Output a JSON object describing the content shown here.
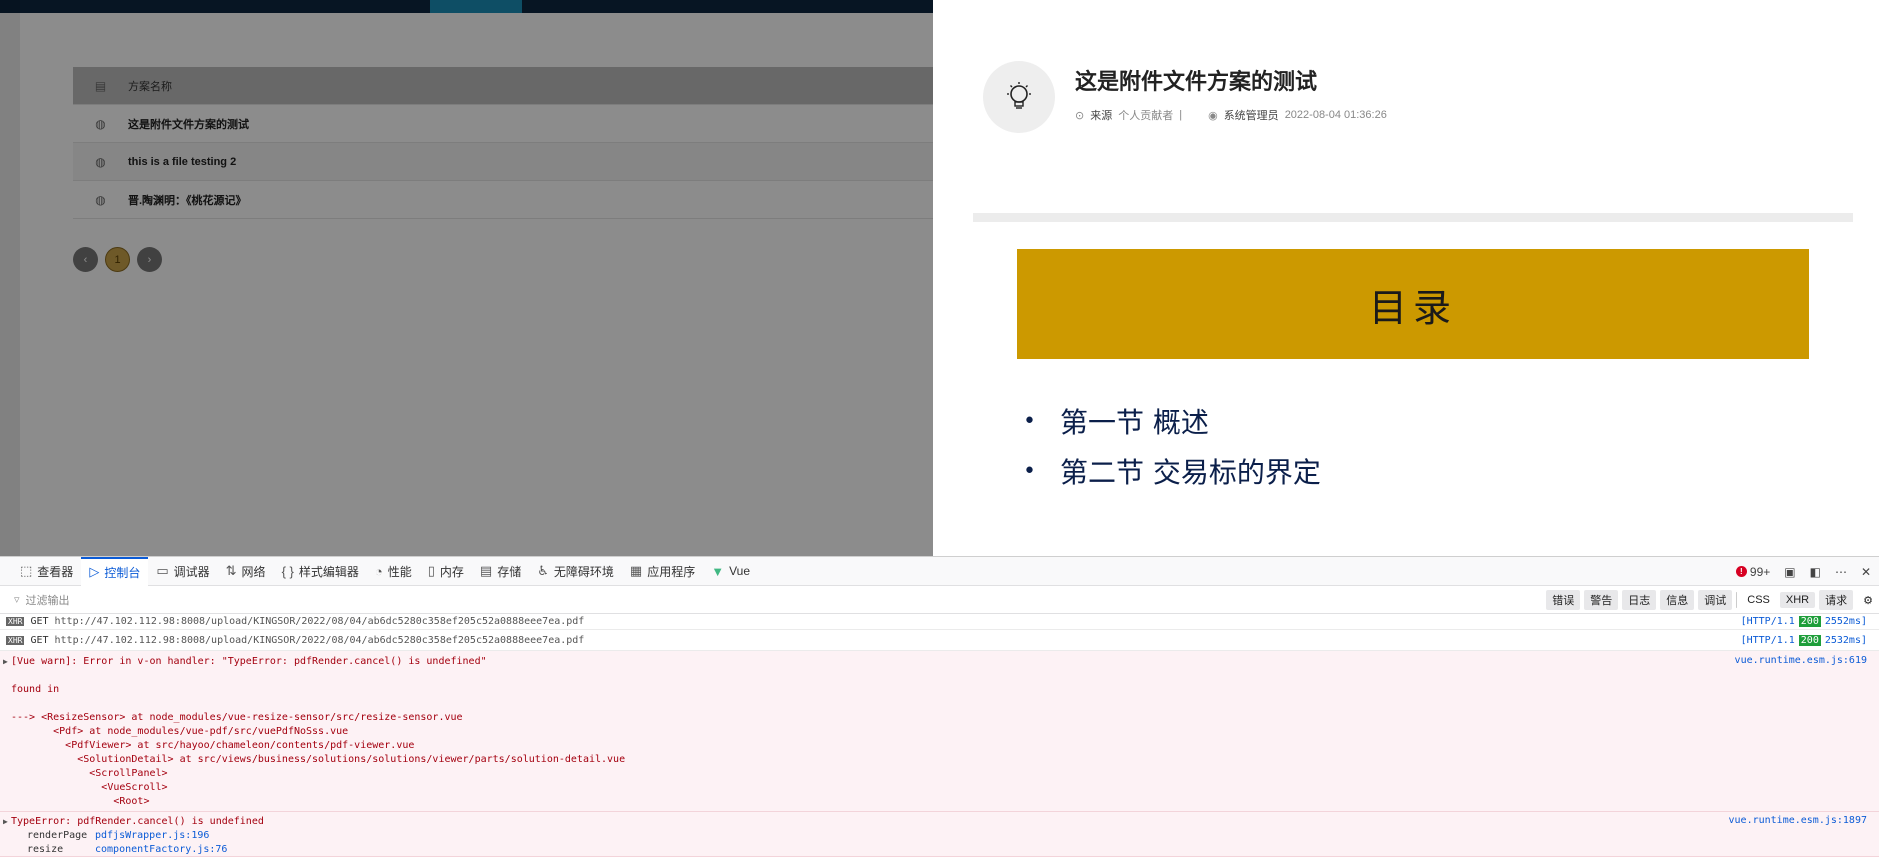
{
  "list": {
    "header": "方案名称",
    "rows": [
      "这是附件文件方案的测试",
      "this is a file testing 2",
      "晋.陶渊明：《桃花源记》"
    ],
    "pager": {
      "prev": "‹",
      "current": "1",
      "next": "›"
    }
  },
  "drawer": {
    "title": "这是附件文件方案的测试",
    "meta": {
      "source_label": "来源",
      "source_value": "个人贡献者",
      "divider": "|",
      "author": "系统管理员",
      "date": "2022-08-04 01:36:26"
    },
    "pdf": {
      "banner": "目录",
      "items": [
        "第一节 概述",
        "第二节 交易标的界定"
      ]
    }
  },
  "devtools": {
    "tabs": [
      {
        "label": "查看器",
        "icon": "⬚"
      },
      {
        "label": "控制台",
        "icon": "▷",
        "active": true
      },
      {
        "label": "调试器",
        "icon": "▭"
      },
      {
        "label": "网络",
        "icon": "⇅"
      },
      {
        "label": "样式编辑器",
        "icon": "{ }"
      },
      {
        "label": "性能",
        "icon": "◔"
      },
      {
        "label": "内存",
        "icon": "▯"
      },
      {
        "label": "存储",
        "icon": "▤"
      },
      {
        "label": "无障碍环境",
        "icon": "♿"
      },
      {
        "label": "应用程序",
        "icon": "▦"
      },
      {
        "label": "Vue",
        "icon": "▼"
      }
    ],
    "error_count": "99+",
    "filter_placeholder": "过滤输出",
    "filters": [
      "错误",
      "警告",
      "日志",
      "信息",
      "调试",
      "CSS",
      "XHR",
      "请求"
    ],
    "logs": [
      {
        "method": "GET",
        "url": "http://47.102.112.98:8008/upload/KINGSOR/2022/08/04/ab6dc5280c358ef205c52a0888eee7ea.pdf",
        "proto": "[HTTP/1.1",
        "code": "200",
        "time": "2552ms]"
      },
      {
        "method": "GET",
        "url": "http://47.102.112.98:8008/upload/KINGSOR/2022/08/04/ab6dc5280c358ef205c52a0888eee7ea.pdf",
        "proto": "[HTTP/1.1",
        "code": "200",
        "time": "2532ms]"
      }
    ],
    "warn": {
      "message": "[Vue warn]: Error in v-on handler: \"TypeError: pdfRender.cancel() is undefined\"",
      "source": "vue.runtime.esm.js:619",
      "found": "found in",
      "trace": [
        "---> <ResizeSensor> at node_modules/vue-resize-sensor/src/resize-sensor.vue",
        "       <Pdf> at node_modules/vue-pdf/src/vuePdfNoSss.vue",
        "         <PdfViewer> at src/hayoo/chameleon/contents/pdf-viewer.vue",
        "           <SolutionDetail> at src/views/business/solutions/solutions/viewer/parts/solution-detail.vue",
        "             <ScrollPanel>",
        "               <VueScroll>",
        "                 <Root>"
      ]
    },
    "error": {
      "message": "TypeError: pdfRender.cancel() is undefined",
      "source": "vue.runtime.esm.js:1897",
      "stack": [
        {
          "fn": "renderPage",
          "file": "pdfjsWrapper.js:196"
        },
        {
          "fn": "resize",
          "file": "componentFactory.js:76"
        }
      ]
    }
  }
}
